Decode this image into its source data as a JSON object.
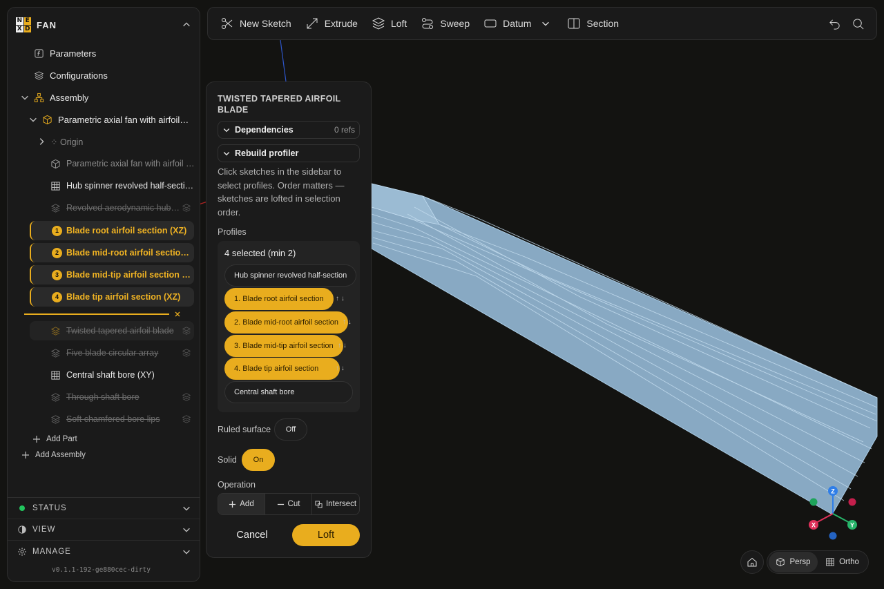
{
  "app": {
    "title": "FAN",
    "logo_letters": [
      "N",
      "E",
      "X",
      "D"
    ]
  },
  "sidebar": {
    "items": [
      {
        "label": "Parameters"
      },
      {
        "label": "Configurations"
      },
      {
        "label": "Assembly"
      },
      {
        "label": "Parametric axial fan with airfoil …"
      },
      {
        "label": "⁘ Origin"
      },
      {
        "label": "Parametric axial fan with airfoil …"
      },
      {
        "label": "Hub spinner revolved half-sectio…"
      },
      {
        "label": "Revolved aerodynamic hub-…"
      },
      {
        "label": "Blade root airfoil section (XZ)",
        "order": "1"
      },
      {
        "label": "Blade mid-root airfoil section…",
        "order": "2"
      },
      {
        "label": "Blade mid-tip airfoil section (…",
        "order": "3"
      },
      {
        "label": "Blade tip airfoil section (XZ)",
        "order": "4"
      },
      {
        "label": "Twisted tapered airfoil blade"
      },
      {
        "label": "Five blade circular array"
      },
      {
        "label": "Central shaft bore (XY)"
      },
      {
        "label": "Through shaft bore"
      },
      {
        "label": "Soft chamfered bore lips"
      }
    ],
    "add_part": "Add Part",
    "add_assembly": "Add Assembly",
    "sections": {
      "status": "STATUS",
      "view": "VIEW",
      "manage": "MANAGE"
    },
    "version": "v0.1.1-192-ge880cec-dirty",
    "colors": {
      "accent": "#e9ad1e",
      "status_dot": "#22c55e"
    }
  },
  "toolbar": {
    "new_sketch": "New Sketch",
    "extrude": "Extrude",
    "loft": "Loft",
    "sweep": "Sweep",
    "datum": "Datum",
    "section": "Section"
  },
  "panel": {
    "title": "TWISTED TAPERED AIRFOIL BLADE",
    "dependencies": "Dependencies",
    "dependencies_meta": "0 refs",
    "rebuild": "Rebuild profiler",
    "hint": "Click sketches in the sidebar to select profiles. Order matters — sketches are lofted in selection order.",
    "profiles_label": "Profiles",
    "selected_count": "4 selected (min 2)",
    "profiles": [
      {
        "label": "Hub spinner revolved half-section",
        "selected": false
      },
      {
        "label": "1. Blade root airfoil section",
        "selected": true,
        "arrows": "↑ ↓"
      },
      {
        "label": "2. Blade mid-root airfoil section",
        "selected": true,
        "arrows": "↑ ↓"
      },
      {
        "label": "3. Blade mid-tip airfoil section",
        "selected": true,
        "arrows": "↑ ↓"
      },
      {
        "label": "4. Blade tip airfoil section",
        "selected": true,
        "arrows": "↑ ↓"
      },
      {
        "label": "Central shaft bore",
        "selected": false
      }
    ],
    "ruled_label": "Ruled surface",
    "ruled_value": "Off",
    "solid_label": "Solid",
    "solid_value": "On",
    "operation_label": "Operation",
    "operations": [
      "Add",
      "Cut",
      "Intersect"
    ],
    "cancel": "Cancel",
    "confirm": "Loft"
  },
  "view": {
    "axes": {
      "z": "Z",
      "x": "X",
      "y": "Y"
    },
    "persp": "Persp",
    "ortho": "Ortho"
  }
}
